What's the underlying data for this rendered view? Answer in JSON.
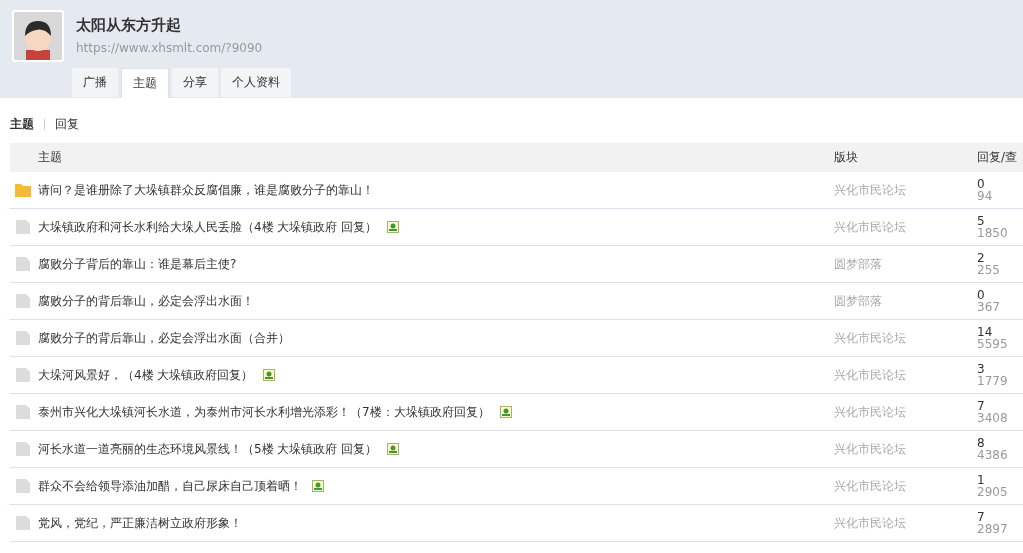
{
  "profile": {
    "name": "太阳从东方升起",
    "url": "https://www.xhsmlt.com/?9090"
  },
  "tabs": [
    {
      "label": "广播",
      "selected": false
    },
    {
      "label": "主题",
      "selected": true
    },
    {
      "label": "分享",
      "selected": false
    },
    {
      "label": "个人资料",
      "selected": false
    }
  ],
  "subnav": [
    {
      "label": "主题",
      "selected": true
    },
    {
      "label": "回复",
      "selected": false
    }
  ],
  "table": {
    "columns": [
      "主题",
      "版块",
      "回复/查"
    ],
    "rows": [
      {
        "kind": "new",
        "title": "请问？是谁册除了大垛镇群众反腐倡廉，谁是腐败分子的靠山！",
        "has_image": false,
        "forum": "兴化市民论坛",
        "replies": "0",
        "views": "94"
      },
      {
        "kind": "normal",
        "title": "大垛镇政府和河长水利给大垛人民丢脸（4楼 大垛镇政府 回复）",
        "has_image": true,
        "forum": "兴化市民论坛",
        "replies": "5",
        "views": "1850"
      },
      {
        "kind": "normal",
        "title": "腐败分子背后的靠山：谁是幕后主使?",
        "has_image": false,
        "forum": "圆梦部落",
        "replies": "2",
        "views": "255"
      },
      {
        "kind": "normal",
        "title": "腐败分子的背后靠山，必定会浮出水面！",
        "has_image": false,
        "forum": "圆梦部落",
        "replies": "0",
        "views": "367"
      },
      {
        "kind": "normal",
        "title": "腐败分子的背后靠山，必定会浮出水面（合并）",
        "has_image": false,
        "forum": "兴化市民论坛",
        "replies": "14",
        "views": "5595"
      },
      {
        "kind": "normal",
        "title": "大垛河风景好，（4楼 大垛镇政府回复）",
        "has_image": true,
        "forum": "兴化市民论坛",
        "replies": "3",
        "views": "1779"
      },
      {
        "kind": "normal",
        "title": "泰州市兴化大垛镇河长水道，为泰州市河长水利增光添彩！（7楼：大垛镇政府回复）",
        "has_image": true,
        "forum": "兴化市民论坛",
        "replies": "7",
        "views": "3408"
      },
      {
        "kind": "normal",
        "title": "河长水道一道亮丽的生态环境风景线！（5楼 大垛镇政府 回复）",
        "has_image": true,
        "forum": "兴化市民论坛",
        "replies": "8",
        "views": "4386"
      },
      {
        "kind": "normal",
        "title": "群众不会给领导添油加醋，自己尿床自己顶着晒！",
        "has_image": true,
        "forum": "兴化市民论坛",
        "replies": "1",
        "views": "2905"
      },
      {
        "kind": "normal",
        "title": "党风，党纪，严正廉洁树立政府形象！",
        "has_image": false,
        "forum": "兴化市民论坛",
        "replies": "7",
        "views": "2897"
      }
    ]
  }
}
